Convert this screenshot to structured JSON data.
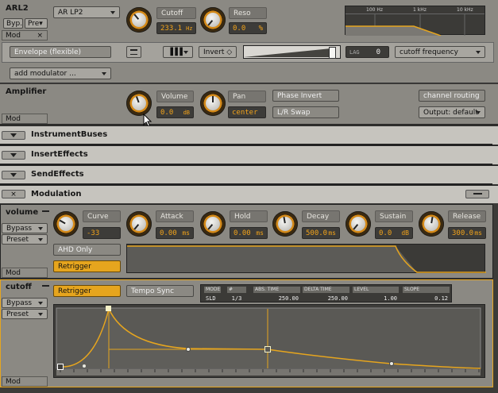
{
  "filter": {
    "title": "ARL2",
    "bypass_label": "Byp.",
    "preset_label": "Pre▾",
    "mod_label": "Mod",
    "type_value": "AR LP2",
    "cutoff": {
      "label": "Cutoff",
      "value": "233.1",
      "unit": "Hz"
    },
    "reso": {
      "label": "Reso",
      "value": "0.0",
      "unit": "%"
    },
    "freq_ticks": [
      "100 Hz",
      "1 kHz",
      "10 kHz"
    ],
    "mod_source": "Envelope (flexible)",
    "invert_label": "Invert ◇",
    "lag_label": "LAG",
    "lag_value": "0",
    "target_value": "cutoff frequency",
    "add_modulator": "add modulator ..."
  },
  "amplifier": {
    "title": "Amplifier",
    "mod_label": "Mod",
    "volume": {
      "label": "Volume",
      "value": "0.0",
      "unit": "dB"
    },
    "pan": {
      "label": "Pan",
      "value": "center"
    },
    "phase_invert": "Phase Invert",
    "lr_swap": "L/R Swap",
    "channel_routing": "channel routing",
    "output": "Output: default"
  },
  "sections": {
    "instrument_buses": "InstrumentBuses",
    "insert_effects": "InsertEffects",
    "send_effects": "SendEffects",
    "modulation": "Modulation"
  },
  "volume_env": {
    "title": "volume",
    "bypass": "Bypass",
    "preset": "Preset",
    "mod": "Mod",
    "knobs": [
      {
        "label": "Curve",
        "value": "-33",
        "unit": ""
      },
      {
        "label": "Attack",
        "value": "0.00",
        "unit": "ms"
      },
      {
        "label": "Hold",
        "value": "0.00",
        "unit": "ms"
      },
      {
        "label": "Decay",
        "value": "500.0",
        "unit": "ms"
      },
      {
        "label": "Sustain",
        "value": "0.0",
        "unit": "dB"
      },
      {
        "label": "Release",
        "value": "300.0",
        "unit": "ms"
      }
    ],
    "ahd_only": "AHD Only",
    "retrigger": "Retrigger"
  },
  "cutoff_env": {
    "title": "cutoff",
    "bypass": "Bypass",
    "preset": "Preset",
    "mod": "Mod",
    "retrigger": "Retrigger",
    "tempo_sync": "Tempo Sync",
    "table_headers": [
      "MODE",
      "#",
      "ABS. TIME",
      "DELTA TIME",
      "LEVEL",
      "SLOPE"
    ],
    "table_values": [
      "SLD",
      "1/3",
      "250.00",
      "250.00",
      "1.00",
      "0.12"
    ]
  },
  "colors": {
    "accent": "#e6a51e",
    "value_text": "#f2a31a",
    "panel": "#8b8983"
  }
}
